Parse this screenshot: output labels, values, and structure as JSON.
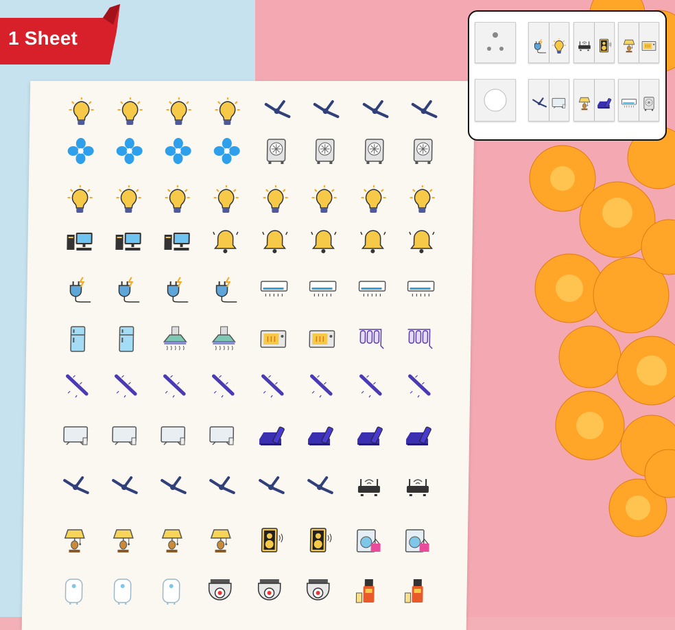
{
  "badge": {
    "label": "1 Sheet",
    "color": "#d8202b"
  },
  "sheet": {
    "rows": 11,
    "columns": 8,
    "grid": [
      [
        "bulb-icon",
        "bulb-icon",
        "bulb-icon",
        "bulb-icon",
        "ceiling-fan-icon",
        "ceiling-fan-icon",
        "ceiling-fan-icon",
        "ceiling-fan-icon"
      ],
      [
        "exhaust-fan-icon",
        "exhaust-fan-icon",
        "exhaust-fan-icon",
        "exhaust-fan-icon",
        "air-cooler-icon",
        "air-cooler-icon",
        "air-cooler-icon",
        "air-cooler-icon"
      ],
      [
        "bulb-icon",
        "bulb-icon",
        "bulb-icon",
        "bulb-icon",
        "bulb-icon",
        "bulb-icon",
        "bulb-icon",
        "bulb-icon"
      ],
      [
        "computer-icon",
        "computer-icon",
        "computer-icon",
        "bell-icon",
        "bell-icon",
        "bell-icon",
        "bell-icon",
        "bell-icon"
      ],
      [
        "power-plug-icon",
        "power-plug-icon",
        "power-plug-icon",
        "power-plug-icon",
        "air-conditioner-icon",
        "air-conditioner-icon",
        "air-conditioner-icon",
        "air-conditioner-icon"
      ],
      [
        "refrigerator-icon",
        "refrigerator-icon",
        "chimney-hood-icon",
        "chimney-hood-icon",
        "microwave-icon",
        "microwave-icon",
        "water-purifier-icon",
        "water-purifier-icon"
      ],
      [
        "tube-light-icon",
        "tube-light-icon",
        "tube-light-icon",
        "tube-light-icon",
        "tube-light-icon",
        "tube-light-icon",
        "tube-light-icon",
        "tube-light-icon"
      ],
      [
        "television-icon",
        "television-icon",
        "television-icon",
        "television-icon",
        "set-top-box-icon",
        "set-top-box-icon",
        "set-top-box-icon",
        "set-top-box-icon"
      ],
      [
        "ceiling-fan-icon",
        "ceiling-fan-icon",
        "ceiling-fan-icon",
        "ceiling-fan-icon",
        "ceiling-fan-icon",
        "ceiling-fan-icon",
        "wifi-router-icon",
        "wifi-router-icon"
      ],
      [
        "table-lamp-icon",
        "table-lamp-icon",
        "table-lamp-icon",
        "table-lamp-icon",
        "speaker-icon",
        "speaker-icon",
        "washing-machine-icon",
        "washing-machine-icon"
      ],
      [
        "water-heater-icon",
        "water-heater-icon",
        "water-heater-icon",
        "cctv-camera-icon",
        "cctv-camera-icon",
        "cctv-camera-icon",
        "juicer-icon",
        "juicer-icon"
      ]
    ]
  },
  "inset": {
    "items": [
      "socket",
      "switch-plug-bulb",
      "switch-router-speaker",
      "switch-lamp-projector",
      "fan-regulator",
      "switch-fan-tv",
      "switch-lamp-settopbox",
      "switch-ac-cooler"
    ]
  },
  "colors": {
    "bulb": "#f7c948",
    "fan_blue": "#2e9fea",
    "navy": "#32407a",
    "purple": "#4a3bb4",
    "background_blue": "#c6e2ef",
    "background_pink": "#f4a9b2",
    "flower_orange": "#ffa629"
  }
}
